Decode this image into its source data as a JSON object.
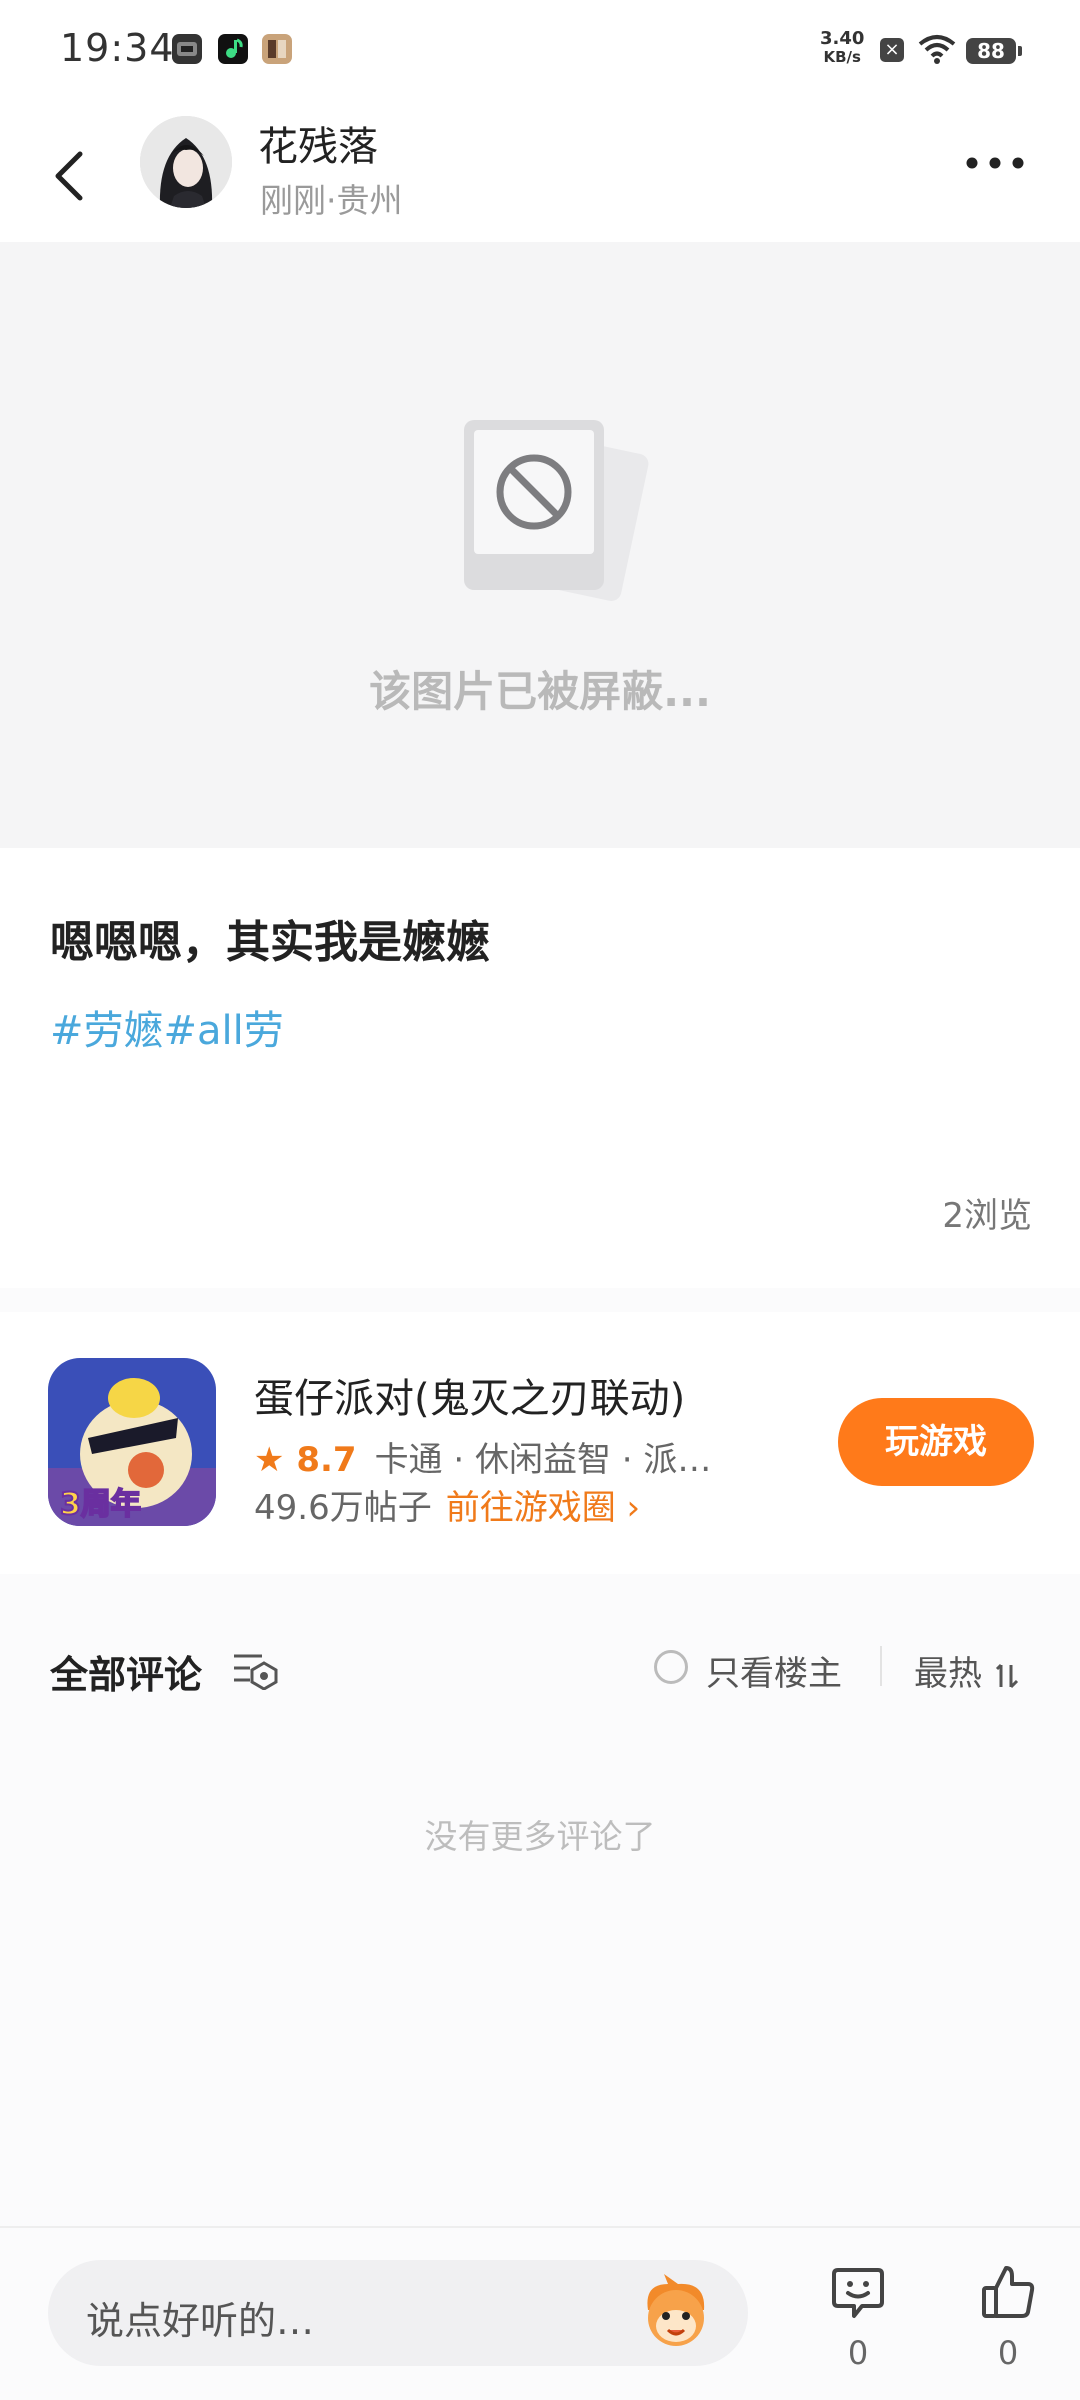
{
  "status_bar": {
    "time": "19:34",
    "speed_value": "3.40",
    "speed_unit": "KB/s",
    "battery": "88",
    "icons": [
      "app-icon-1",
      "app-icon-2",
      "app-icon-3",
      "close-box-icon",
      "wifi-icon",
      "battery-icon"
    ]
  },
  "header": {
    "user_name": "花残落",
    "user_meta": "刚刚·贵州",
    "icons": [
      "back-arrow-icon",
      "more-icon"
    ]
  },
  "blocked_image": {
    "message": "该图片已被屏蔽...",
    "icon": "blocked-image-icon"
  },
  "post": {
    "text": "嗯嗯嗯，其实我是嬷嬷",
    "tags": [
      "#劳嬷",
      "#all劳"
    ],
    "tag_color": "#4aa8dc",
    "views": "2浏览"
  },
  "game_card": {
    "title": "蛋仔派对(鬼灭之刃联动)",
    "rating": "8.7",
    "genres": "卡通 · 休闲益智 · 派…",
    "posts": "49.6万帖子",
    "link_label": "前往游戏圈",
    "play_button": "玩游戏",
    "icon_badge": "3周年",
    "accent_color": "#ff7a1a"
  },
  "comments": {
    "title": "全部评论",
    "only_op_label": "只看楼主",
    "sort_label": "最热",
    "empty_text": "没有更多评论了"
  },
  "bottom_bar": {
    "input_placeholder": "说点好听的…",
    "comment_count": "0",
    "like_count": "0"
  }
}
